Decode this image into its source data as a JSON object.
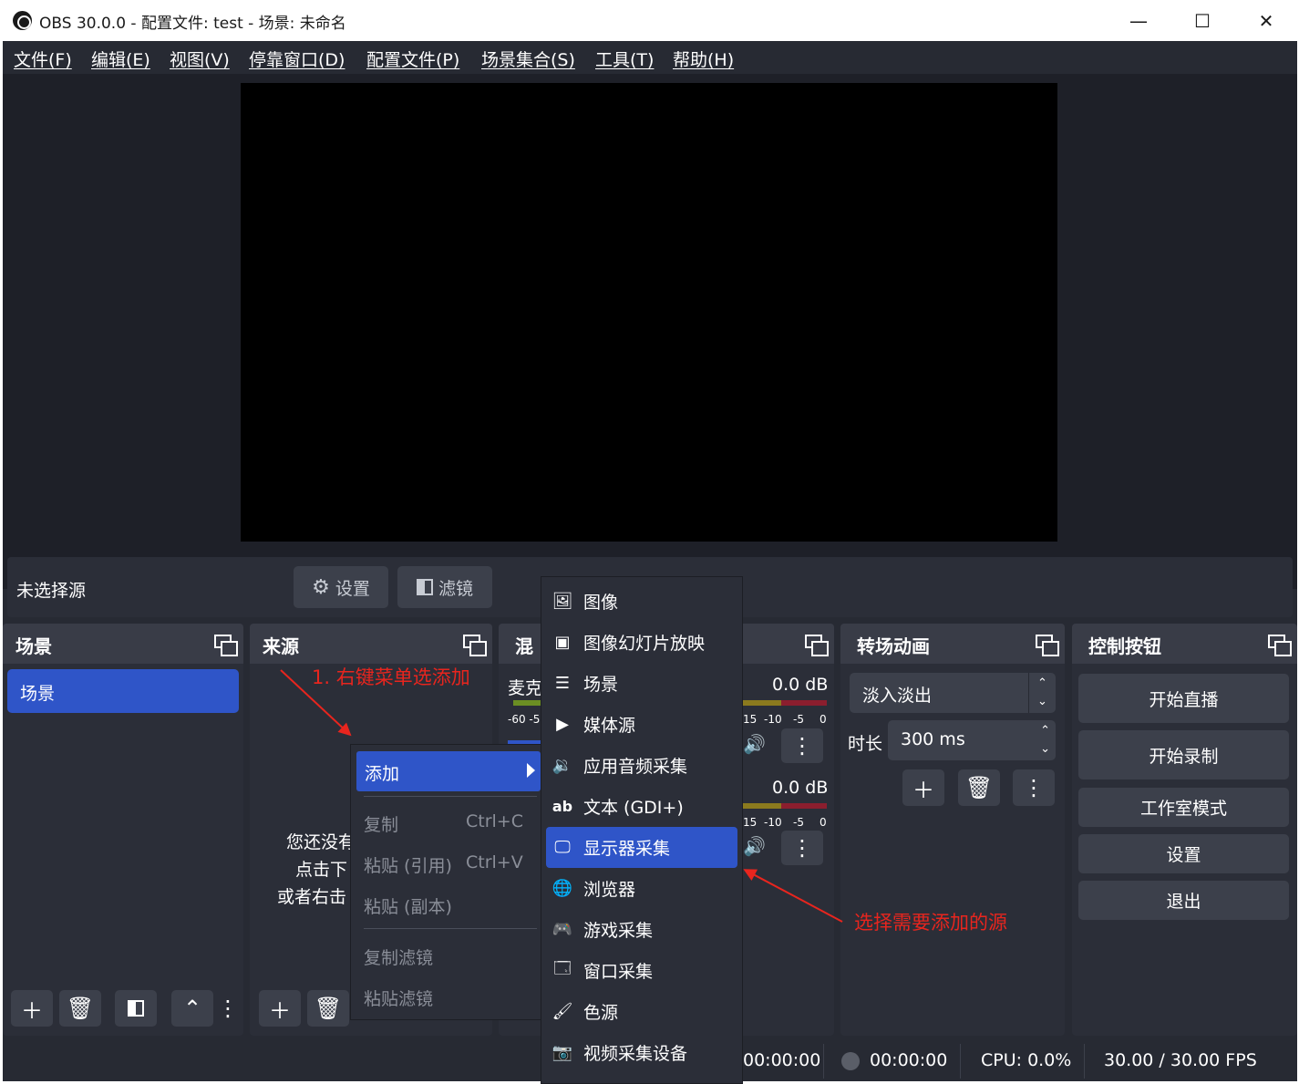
{
  "window": {
    "title": "OBS 30.0.0 - 配置文件: test - 场景: 未命名",
    "minimize": "—",
    "maximize": "☐",
    "close": "✕"
  },
  "menu": [
    "文件(F)",
    "编辑(E)",
    "视图(V)",
    "停靠窗口(D)",
    "配置文件(P)",
    "场景集合(S)",
    "工具(T)",
    "帮助(H)"
  ],
  "source_toolbar": {
    "no_source": "未选择源",
    "settings": "设置",
    "filters": "滤镜"
  },
  "docks": {
    "scenes": {
      "title": "场景",
      "items": [
        "场景"
      ]
    },
    "sources": {
      "title": "来源",
      "empty_line1": "您还没有",
      "empty_line2": "点击下",
      "empty_line3": "或者右击"
    },
    "mixer": {
      "title": "混",
      "channel1_name": "麦克",
      "channel1_db": "0.0 dB",
      "channel2_db": "0.0 dB",
      "ticks_left": "-60 -5",
      "ticks_right": [
        "15",
        "-10",
        "-5",
        "0"
      ]
    },
    "transitions": {
      "title": "转场动画",
      "type": "淡入淡出",
      "duration_label": "时长",
      "duration_value": "300 ms"
    },
    "controls": {
      "title": "控制按钮",
      "buttons": [
        "开始直播",
        "开始录制",
        "工作室模式",
        "设置",
        "退出"
      ]
    }
  },
  "annotations": {
    "step1": "1. 右键菜单选添加",
    "step2": "选择需要添加的源"
  },
  "context_menu": {
    "add": "添加",
    "copy": "复制",
    "copy_shortcut": "Ctrl+C",
    "paste_ref": "粘贴 (引用)",
    "paste_ref_shortcut": "Ctrl+V",
    "paste_dup": "粘贴 (副本)",
    "copy_filters": "复制滤镜",
    "paste_filters": "粘贴滤镜"
  },
  "submenu": [
    "图像",
    "图像幻灯片放映",
    "场景",
    "媒体源",
    "应用音频采集",
    "文本 (GDI+)",
    "显示器采集",
    "浏览器",
    "游戏采集",
    "窗口采集",
    "色源",
    "视频采集设备"
  ],
  "status": {
    "stream_time": "00:00:00",
    "record_time": "00:00:00",
    "cpu": "CPU: 0.0%",
    "fps": "30.00 / 30.00 FPS"
  },
  "colors": {
    "accent": "#2f55c8",
    "background": "#272a33",
    "panel": "#2b2e38",
    "annotation": "#e8251e"
  }
}
